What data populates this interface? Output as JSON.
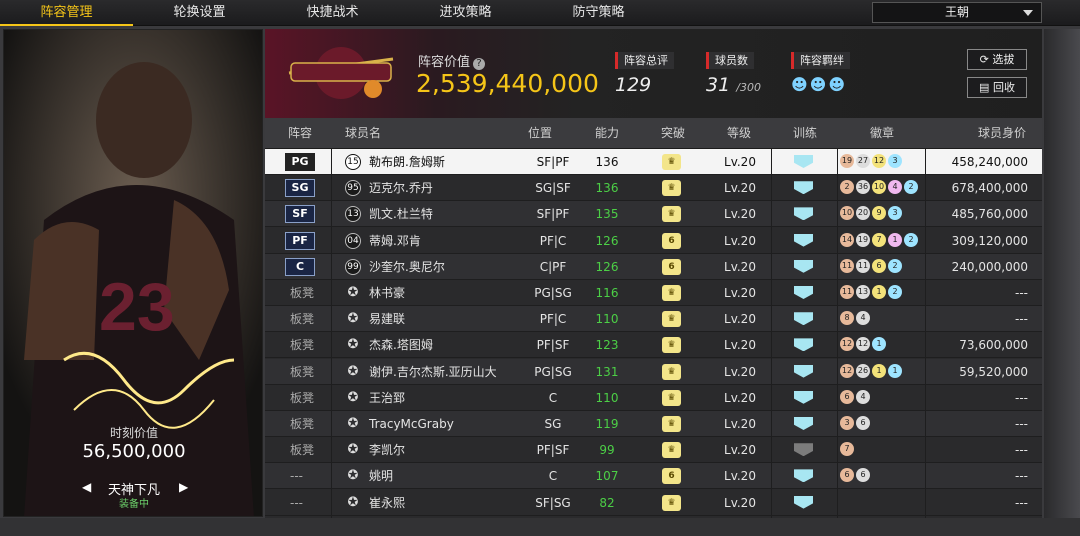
{
  "nav": {
    "tabs": [
      "阵容管理",
      "轮换设置",
      "快捷战术",
      "进攻策略",
      "防守策略"
    ],
    "active_tab": 0,
    "team_select": "王朝"
  },
  "card": {
    "market_label": "时刻价值",
    "market_value": "56,500,000",
    "style_name": "天神下凡",
    "style_status": "装备中"
  },
  "header": {
    "lineup_value_label": "阵容价值",
    "lineup_value": "2,539,440,000",
    "overall_label": "阵容总评",
    "overall_value": "129",
    "players_label": "球员数",
    "players_value": "31",
    "players_max": "/300",
    "bond_label": "阵容羁绊",
    "select_button": "选拔",
    "recycle_button": "回收"
  },
  "table": {
    "headers": [
      "阵容",
      "球员名",
      "位置",
      "能力",
      "突破",
      "等级",
      "训练",
      "徽章",
      "球员身价"
    ],
    "rows": [
      {
        "slot": "PG",
        "bench": false,
        "num": "15",
        "name": "勒布朗.詹姆斯",
        "pos": "SF|PF",
        "rating": "136",
        "brk": "",
        "level": "Lv.20",
        "train": "blue",
        "badges": [
          [
            "19",
            "bronze"
          ],
          [
            "27",
            "silver"
          ],
          [
            "12",
            "gold"
          ],
          [
            "3",
            "blue"
          ]
        ],
        "salary": "458,240,000",
        "selected": true
      },
      {
        "slot": "SG",
        "bench": false,
        "num": "95",
        "name": "迈克尔.乔丹",
        "pos": "SG|SF",
        "rating": "136",
        "brk": "",
        "level": "Lv.20",
        "train": "blue",
        "badges": [
          [
            "2",
            "bronze"
          ],
          [
            "36",
            "silver"
          ],
          [
            "10",
            "gold"
          ],
          [
            "4",
            "pink"
          ],
          [
            "2",
            "blue"
          ]
        ],
        "salary": "678,400,000"
      },
      {
        "slot": "SF",
        "bench": false,
        "num": "13",
        "name": "凯文.杜兰特",
        "pos": "SF|PF",
        "rating": "135",
        "brk": "",
        "level": "Lv.20",
        "train": "blue",
        "badges": [
          [
            "10",
            "bronze"
          ],
          [
            "20",
            "silver"
          ],
          [
            "9",
            "gold"
          ],
          [
            "3",
            "blue"
          ]
        ],
        "salary": "485,760,000"
      },
      {
        "slot": "PF",
        "bench": false,
        "num": "04",
        "name": "蒂姆.邓肯",
        "pos": "PF|C",
        "rating": "126",
        "brk": "6",
        "level": "Lv.20",
        "train": "blue",
        "badges": [
          [
            "14",
            "bronze"
          ],
          [
            "19",
            "silver"
          ],
          [
            "7",
            "gold"
          ],
          [
            "1",
            "pink"
          ],
          [
            "2",
            "blue"
          ]
        ],
        "salary": "309,120,000"
      },
      {
        "slot": "C",
        "bench": false,
        "num": "99",
        "name": "沙奎尔.奥尼尔",
        "pos": "C|PF",
        "rating": "126",
        "brk": "6",
        "level": "Lv.20",
        "train": "blue",
        "badges": [
          [
            "11",
            "bronze"
          ],
          [
            "11",
            "silver"
          ],
          [
            "6",
            "gold"
          ],
          [
            "2",
            "blue"
          ]
        ],
        "salary": "240,000,000"
      },
      {
        "slot": "板凳",
        "bench": true,
        "num": "",
        "name": "林书豪",
        "pos": "PG|SG",
        "rating": "116",
        "brk": "",
        "level": "Lv.20",
        "train": "blue",
        "badges": [
          [
            "11",
            "bronze"
          ],
          [
            "13",
            "silver"
          ],
          [
            "1",
            "gold"
          ],
          [
            "2",
            "blue"
          ]
        ],
        "salary": "---"
      },
      {
        "slot": "板凳",
        "bench": true,
        "num": "",
        "name": "易建联",
        "pos": "PF|C",
        "rating": "110",
        "brk": "",
        "level": "Lv.20",
        "train": "blue",
        "badges": [
          [
            "8",
            "bronze"
          ],
          [
            "4",
            "silver"
          ]
        ],
        "salary": "---"
      },
      {
        "slot": "板凳",
        "bench": true,
        "num": "",
        "name": "杰森.塔图姆",
        "pos": "PF|SF",
        "rating": "123",
        "brk": "",
        "level": "Lv.20",
        "train": "blue",
        "badges": [
          [
            "12",
            "bronze"
          ],
          [
            "12",
            "silver"
          ],
          [
            "1",
            "blue"
          ]
        ],
        "salary": "73,600,000"
      },
      {
        "slot": "板凳",
        "bench": true,
        "num": "",
        "name": "谢伊.吉尔杰斯.亚历山大",
        "pos": "PG|SG",
        "rating": "131",
        "brk": "",
        "level": "Lv.20",
        "train": "blue",
        "badges": [
          [
            "12",
            "bronze"
          ],
          [
            "26",
            "silver"
          ],
          [
            "1",
            "gold"
          ],
          [
            "1",
            "blue"
          ]
        ],
        "salary": "59,520,000"
      },
      {
        "slot": "板凳",
        "bench": true,
        "num": "",
        "name": "王治郅",
        "pos": "C",
        "rating": "110",
        "brk": "",
        "level": "Lv.20",
        "train": "blue",
        "badges": [
          [
            "6",
            "bronze"
          ],
          [
            "4",
            "silver"
          ]
        ],
        "salary": "---"
      },
      {
        "slot": "板凳",
        "bench": true,
        "num": "",
        "name": "TracyMcGraby",
        "pos": "SG",
        "rating": "119",
        "brk": "",
        "level": "Lv.20",
        "train": "blue",
        "badges": [
          [
            "3",
            "bronze"
          ],
          [
            "6",
            "silver"
          ]
        ],
        "salary": "---"
      },
      {
        "slot": "板凳",
        "bench": true,
        "num": "",
        "name": "李凯尔",
        "pos": "PF|SF",
        "rating": "99",
        "brk": "",
        "level": "Lv.20",
        "train": "grey",
        "badges": [
          [
            "7",
            "bronze"
          ]
        ],
        "salary": "---"
      },
      {
        "slot": "---",
        "bench": true,
        "num": "",
        "name": "姚明",
        "pos": "C",
        "rating": "107",
        "brk": "6",
        "level": "Lv.20",
        "train": "blue",
        "badges": [
          [
            "6",
            "bronze"
          ],
          [
            "6",
            "silver"
          ]
        ],
        "salary": "---"
      },
      {
        "slot": "---",
        "bench": true,
        "num": "",
        "name": "崔永熙",
        "pos": "SF|SG",
        "rating": "82",
        "brk": "",
        "level": "Lv.20",
        "train": "blue",
        "badges": [],
        "salary": "---"
      }
    ]
  },
  "colors": {
    "accent": "#f5c518",
    "rating_green": "#4ccf46",
    "stat_red": "#d62a2a"
  }
}
